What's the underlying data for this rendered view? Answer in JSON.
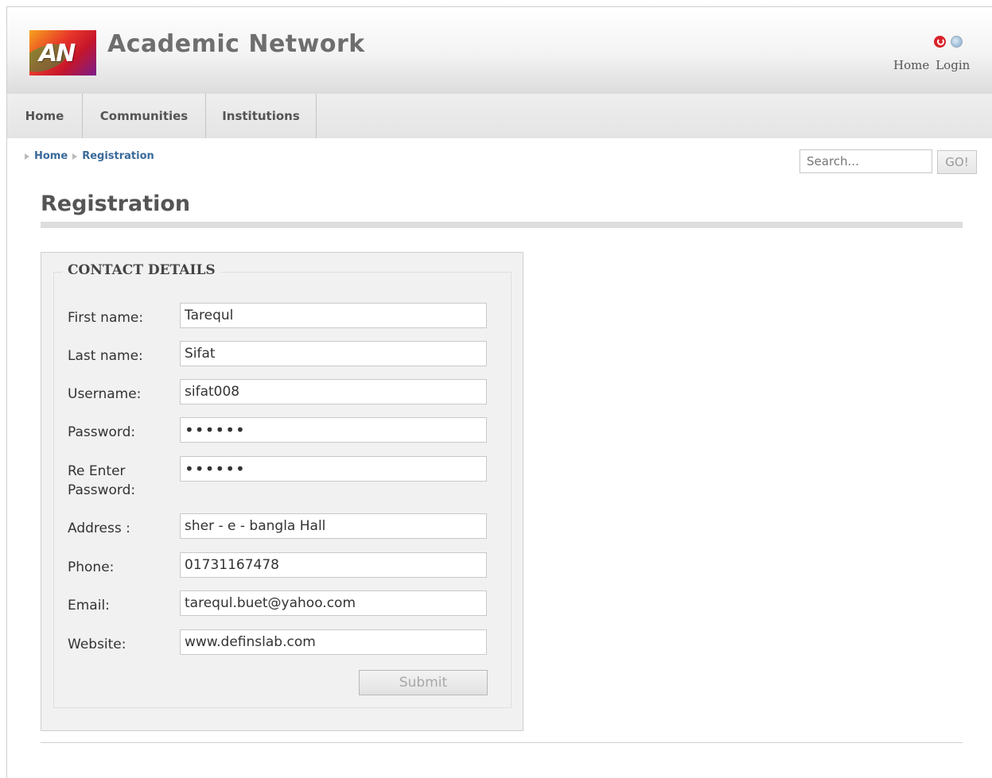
{
  "header": {
    "site_title": "Academic Network",
    "logo_text": "AN",
    "icons": [
      "power-icon",
      "globe-icon"
    ],
    "links": [
      "Home",
      "Login"
    ]
  },
  "nav": {
    "items": [
      "Home",
      "Communities",
      "Institutions"
    ]
  },
  "breadcrumb": {
    "items": [
      "Home",
      "Registration"
    ]
  },
  "search": {
    "placeholder": "Search...",
    "button_label": "GO!"
  },
  "page": {
    "title": "Registration"
  },
  "form": {
    "legend": "CONTACT DETAILS",
    "fields": [
      {
        "label": "First name:",
        "value": "Tarequl"
      },
      {
        "label": "Last name:",
        "value": "Sifat"
      },
      {
        "label": "Username:",
        "value": "sifat008"
      },
      {
        "label": "Password:",
        "value": "••••••"
      },
      {
        "label": "Re Enter Password:",
        "value": "••••••"
      },
      {
        "label": "Address :",
        "value": "sher - e - bangla Hall"
      },
      {
        "label": "Phone:",
        "value": "01731167478"
      },
      {
        "label": "Email:",
        "value": "tarequl.buet@yahoo.com"
      },
      {
        "label": "Website:",
        "value": "www.definslab.com"
      }
    ],
    "submit_label": "Submit"
  },
  "colors": {
    "link": "#3a6a9a",
    "title_gray": "#6e6e6e",
    "accent_red": "#d8232a"
  }
}
